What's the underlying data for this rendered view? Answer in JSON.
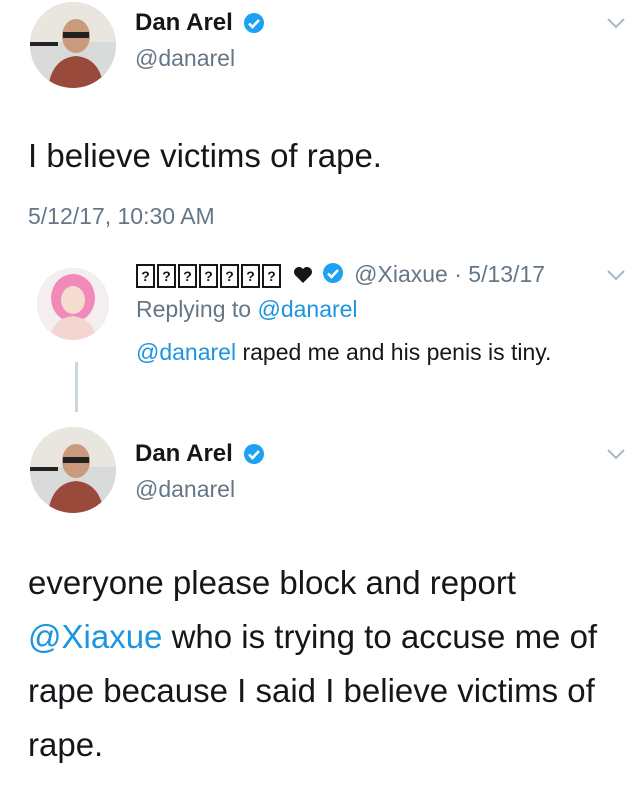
{
  "tweet1": {
    "name": "Dan Arel",
    "handle": "@danarel",
    "text": "I believe victims of rape.",
    "timestamp": "5/12/17, 10:30 AM"
  },
  "reply": {
    "name_glyphs": [
      "?",
      "?",
      "?",
      "?",
      "?",
      "?",
      "?"
    ],
    "handle_date": "@Xiaxue · 5/13/17",
    "replying_prefix": "Replying to",
    "replying_handle": "@danarel",
    "mention": "@danarel",
    "text": "raped me and his penis is tiny."
  },
  "tweet2": {
    "name": "Dan Arel",
    "handle": "@danarel",
    "text_before": "everyone please block and report",
    "mention": "@Xiaxue",
    "text_after": "who is trying to accuse me of rape because I said I believe victims of rape."
  },
  "icons": {
    "verified": "verified-badge-icon",
    "chevron": "chevron-down-icon",
    "heart": "heart-icon"
  },
  "colors": {
    "link": "#1b95e0",
    "secondary": "#657786",
    "verified": "#1da1f2"
  }
}
